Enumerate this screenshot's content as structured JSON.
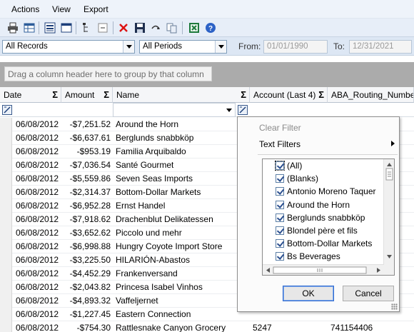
{
  "menu": [
    "Actions",
    "View",
    "Export"
  ],
  "toolbar_icons": [
    "print-icon",
    "table-icon",
    "layout-list-icon",
    "window-icon",
    "tree-icon",
    "collapse-icon",
    "delete-icon",
    "save-icon",
    "undo-icon",
    "copy-icon",
    "excel-icon",
    "help-icon"
  ],
  "filters": {
    "records": "All Records",
    "periods": "All Periods",
    "from_label": "From:",
    "from_value": "01/01/1990",
    "to_label": "To:",
    "to_value": "12/31/2021"
  },
  "group_hint": "Drag a column header here to group by that column",
  "columns": [
    "Date",
    "Amount",
    "Name",
    "Account (Last 4)",
    "ABA_Routing_Number"
  ],
  "rows": [
    {
      "date": "06/08/2012",
      "amount": "-$7,251.52",
      "name": "Around the Horn",
      "account": "",
      "aba": ""
    },
    {
      "date": "06/08/2012",
      "amount": "-$6,637.61",
      "name": "Berglunds snabbköp",
      "account": "",
      "aba": ""
    },
    {
      "date": "06/08/2012",
      "amount": "-$953.19",
      "name": "Familia Arquibaldo",
      "account": "",
      "aba": ""
    },
    {
      "date": "06/08/2012",
      "amount": "-$7,036.54",
      "name": "Santé Gourmet",
      "account": "",
      "aba": ""
    },
    {
      "date": "06/08/2012",
      "amount": "-$5,559.86",
      "name": "Seven Seas Imports",
      "account": "",
      "aba": ""
    },
    {
      "date": "06/08/2012",
      "amount": "-$2,314.37",
      "name": "Bottom-Dollar Markets",
      "account": "",
      "aba": ""
    },
    {
      "date": "06/08/2012",
      "amount": "-$6,952.28",
      "name": "Ernst Handel",
      "account": "",
      "aba": ""
    },
    {
      "date": "06/08/2012",
      "amount": "-$7,918.62",
      "name": "Drachenblut Delikatessen",
      "account": "",
      "aba": ""
    },
    {
      "date": "06/08/2012",
      "amount": "-$3,652.62",
      "name": "Piccolo und mehr",
      "account": "",
      "aba": ""
    },
    {
      "date": "06/08/2012",
      "amount": "-$6,998.88",
      "name": "Hungry Coyote Import Store",
      "account": "",
      "aba": ""
    },
    {
      "date": "06/08/2012",
      "amount": "-$3,225.50",
      "name": "HILARIÓN-Abastos",
      "account": "",
      "aba": ""
    },
    {
      "date": "06/08/2012",
      "amount": "-$4,452.29",
      "name": "Frankenversand",
      "account": "",
      "aba": ""
    },
    {
      "date": "06/08/2012",
      "amount": "-$2,043.82",
      "name": "Princesa Isabel Vinhos",
      "account": "",
      "aba": ""
    },
    {
      "date": "06/08/2012",
      "amount": "-$4,893.32",
      "name": "Vaffeljernet",
      "account": "",
      "aba": ""
    },
    {
      "date": "06/08/2012",
      "amount": "-$1,227.45",
      "name": "Eastern Connection",
      "account": "",
      "aba": ""
    },
    {
      "date": "06/08/2012",
      "amount": "-$754.30",
      "name": "Rattlesnake Canyon Grocery",
      "account": "5247",
      "aba": "741154406"
    }
  ],
  "popup": {
    "clear_filter": "Clear Filter",
    "text_filters": "Text Filters",
    "items": [
      "(All)",
      "(Blanks)",
      "Antonio Moreno Taquer",
      "Around the Horn",
      "Berglunds snabbköp",
      "Blondel père et fils",
      "Bottom-Dollar Markets",
      "Bs Beverages"
    ],
    "ok": "OK",
    "cancel": "Cancel"
  },
  "colors": {
    "accent": "#2f6ad0",
    "group_bar": "#ababab"
  }
}
